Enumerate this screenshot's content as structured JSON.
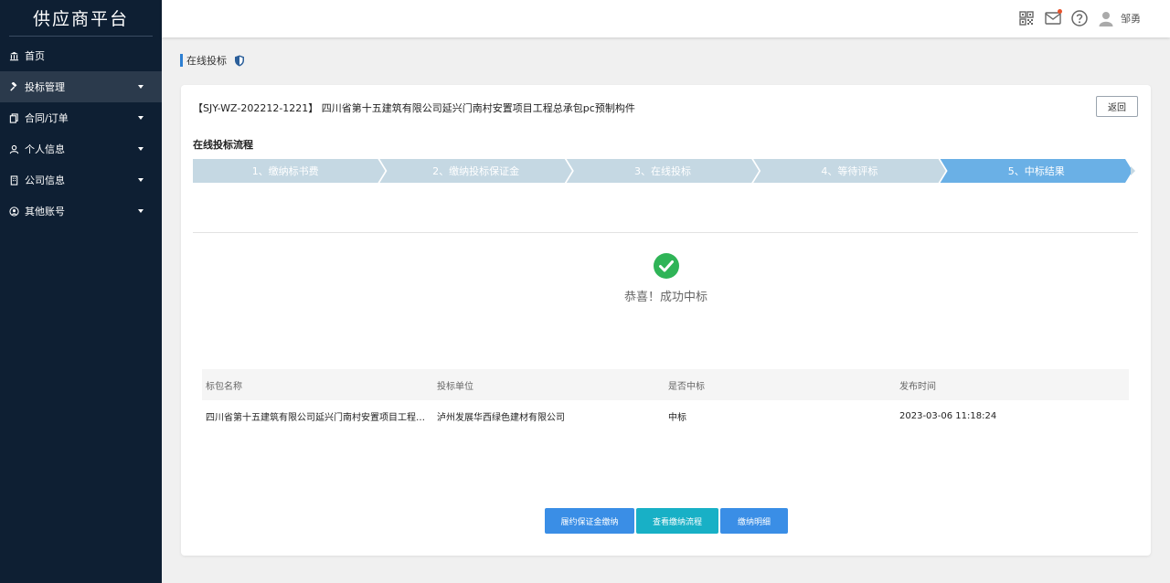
{
  "sidebar": {
    "brand": "供应商平台",
    "items": [
      {
        "label": "首页",
        "icon": "bank-icon",
        "active": false,
        "caret": false
      },
      {
        "label": "投标管理",
        "icon": "gavel-icon",
        "active": true,
        "caret": true
      },
      {
        "label": "合同/订单",
        "icon": "copy-icon",
        "active": false,
        "caret": true
      },
      {
        "label": "个人信息",
        "icon": "user-icon",
        "active": false,
        "caret": true
      },
      {
        "label": "公司信息",
        "icon": "building-icon",
        "active": false,
        "caret": true
      },
      {
        "label": "其他账号",
        "icon": "account-circle-icon",
        "active": false,
        "caret": true
      }
    ]
  },
  "header": {
    "icons": [
      "qrcode-icon",
      "mail-icon",
      "help-icon",
      "avatar-icon"
    ],
    "username": "邹勇"
  },
  "breadcrumb": {
    "label": "在线投标"
  },
  "card": {
    "project_title": "【SJY-WZ-202212-1221】 四川省第十五建筑有限公司延兴门南村安置项目工程总承包pc预制构件",
    "back_label": "返回",
    "flow_title": "在线投标流程",
    "steps": [
      "1、缴纳标书费",
      "2、缴纳投标保证金",
      "3、在线投标",
      "4、等待评标",
      "5、中标结果"
    ],
    "active_step": 5,
    "colors": {
      "step_inactive": "#c5d8e3",
      "step_active": "#6ab0e6",
      "success": "#2fb457"
    },
    "success_text": "恭喜！成功中标",
    "table": {
      "headers": [
        "标包名称",
        "投标单位",
        "是否中标",
        "发布时间"
      ],
      "rows": [
        [
          "四川省第十五建筑有限公司延兴门南村安置项目工程总...",
          "泸州发展华西绿色建材有限公司",
          "中标",
          "2023-03-06 11:18:24"
        ]
      ]
    },
    "buttons": [
      "履约保证金缴纳",
      "查看缴纳流程",
      "缴纳明细"
    ]
  }
}
